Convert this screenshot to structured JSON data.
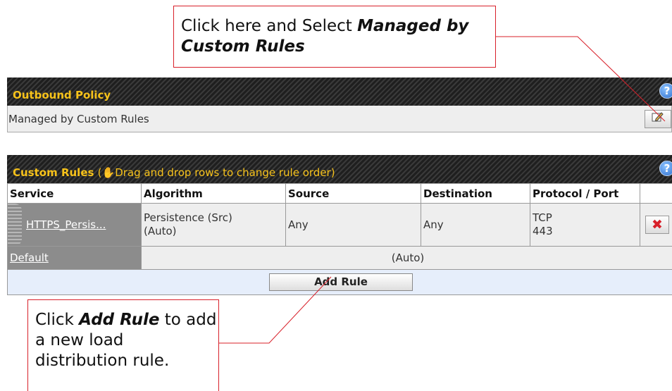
{
  "callouts": {
    "top": {
      "pre": "Click here and Select ",
      "em": "Managed by Custom Rules"
    },
    "bottom": {
      "pre": "Click ",
      "em": "Add Rule",
      "post": " to add a new load distribution rule."
    }
  },
  "outbound_policy": {
    "title": "Outbound Policy",
    "value": "Managed by Custom Rules",
    "edit_icon": "edit-pencil-icon",
    "help_icon": "?"
  },
  "custom_rules": {
    "title": "Custom Rules",
    "drag_note_open": "(",
    "drag_note": "Drag and drop rows to change rule order)",
    "help_icon": "?",
    "columns": [
      "Service",
      "Algorithm",
      "Source",
      "Destination",
      "Protocol / Port"
    ],
    "rows": [
      {
        "service": "HTTPS_Persis...",
        "algorithm_line1": "Persistence (Src)",
        "algorithm_line2": "(Auto)",
        "source": "Any",
        "destination": "Any",
        "protocol": "TCP",
        "port": "443",
        "delete_icon": "✖"
      }
    ],
    "default_row": {
      "service": "Default",
      "algorithm": "(Auto)"
    },
    "add_button": "Add Rule"
  },
  "colors": {
    "header_text": "#f7c21a",
    "callout_border": "#d8202a",
    "add_row_bg": "#e6eefb"
  }
}
